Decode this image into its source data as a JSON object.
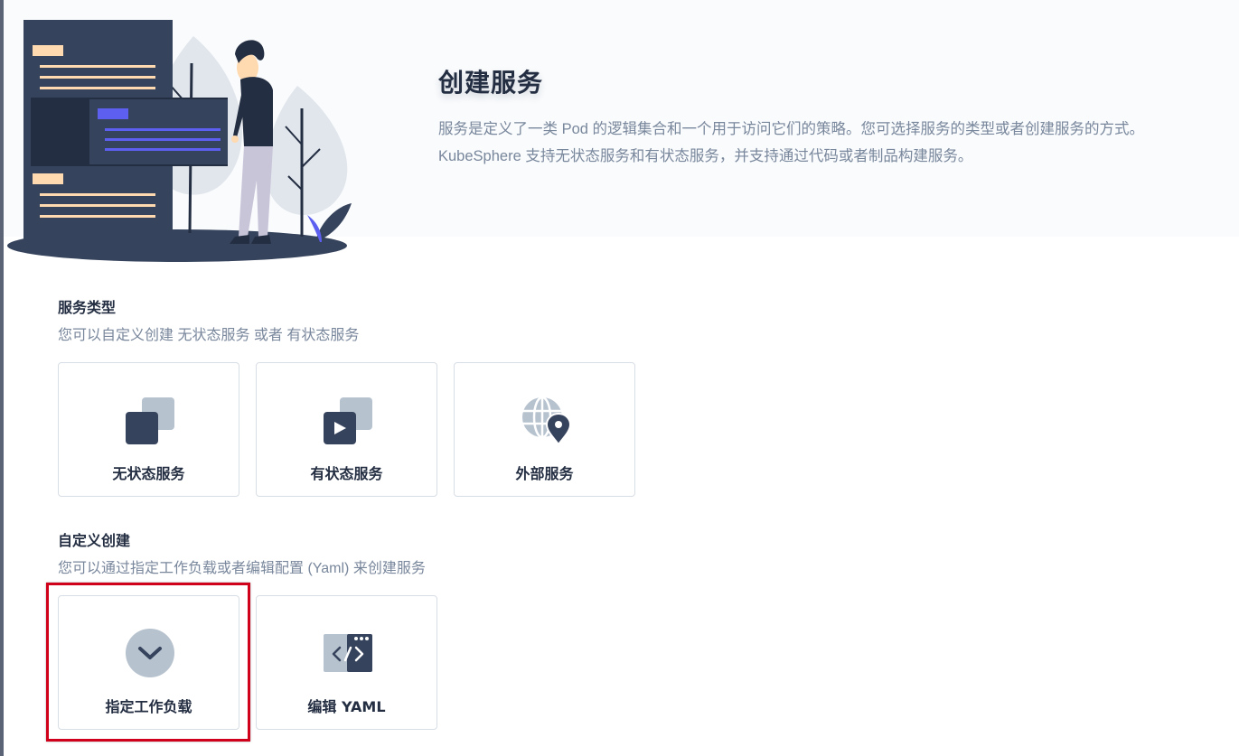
{
  "hero": {
    "title": "创建服务",
    "description_line1": "服务是定义了一类 Pod 的逻辑集合和一个用于访问它们的策略。您可选择服务的类型或者创建服务的方式。",
    "description_line2": "KubeSphere 支持无状态服务和有状态服务，并支持通过代码或者制品构建服务。"
  },
  "service_types": {
    "title": "服务类型",
    "description": "您可以自定义创建 无状态服务 或者 有状态服务",
    "cards": [
      {
        "label": "无状态服务",
        "icon": "stateless-service-icon"
      },
      {
        "label": "有状态服务",
        "icon": "stateful-service-icon"
      },
      {
        "label": "外部服务",
        "icon": "external-service-icon"
      }
    ]
  },
  "custom_create": {
    "title": "自定义创建",
    "description": "您可以通过指定工作负载或者编辑配置 (Yaml) 来创建服务",
    "cards": [
      {
        "label": "指定工作负载",
        "icon": "check-circle-icon",
        "highlighted": true
      },
      {
        "label": "编辑 YAML",
        "icon": "code-window-icon"
      }
    ]
  },
  "colors": {
    "dark": "#36435c",
    "light": "#b7c2cf",
    "muted_text": "#79879c",
    "highlight": "#d0021b",
    "accent_purple": "#5c5ff0",
    "accent_peach": "#ffd9b0"
  }
}
